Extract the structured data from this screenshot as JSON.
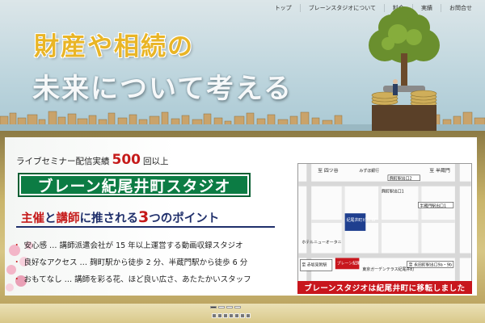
{
  "header": {
    "tagline_lines": [
      "",
      ""
    ],
    "nav": [
      "トップ",
      "ブレーンスタジオについて",
      "料金",
      "実績",
      "お問合せ"
    ]
  },
  "hero": {
    "title_line1": "財産や相続の",
    "title_line2": "未来について考える"
  },
  "banner": {
    "live_prefix": "ライブセミナー配信実績",
    "live_number": "500",
    "live_suffix": "回以上",
    "studio_name": "ブレーン紀尾井町スタジオ",
    "point_a": "主催",
    "point_and": "と",
    "point_b": "講師",
    "point_rest": "に推される",
    "point_num": "3",
    "point_tail": "つのポイント",
    "bullets": [
      "安心感 … 講師派遣会社が 15 年以上運営する動画収録スタジオ",
      "良好なアクセス … 麹町駅から徒歩 2 分、半蔵門駅から徒歩 6 分",
      "おもてなし … 講師を彩る花、ほど良い広さ、あたたかいスタッフ"
    ],
    "move_notice": "ブレーンスタジオは紀尾井町に移転しました",
    "map": {
      "labels": {
        "yotsuya": "至 四ツ谷",
        "hanzomon": "至 半蔵門",
        "mizuho": "みずほ銀行",
        "kojimachi_exit2": "麹町駅出口2",
        "akasaka": "至 赤坂見附駅",
        "nagatacho": "至 永田町駅出口9a・9b",
        "kojimachi_exit1": "麹町駅出口1",
        "hanzomon_exit1": "半蔵門駅出口1",
        "studio": "紀尾井町ビル 6F",
        "studio_box": "ブレーン紀尾井町スタジオ",
        "hotel": "ホテルニューオータニ",
        "yotsuya_exit": "赤坂見附駅出口D",
        "garden": "東京ガーデンテラス紀尾井町"
      }
    }
  },
  "slider": {
    "indicators": 4,
    "active_index": 0,
    "thumbs": 7
  },
  "colors": {
    "accent_red": "#c51a1a",
    "studio_green": "#0c7c44",
    "navy": "#1f2f6b",
    "hero_gold": "#e9b526",
    "strip_red": "#c8161d"
  }
}
